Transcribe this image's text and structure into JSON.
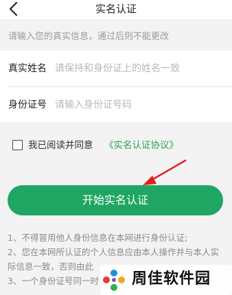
{
  "header": {
    "title": "实名认证"
  },
  "notice": "请输入您的真实信息，通过后则不能更改",
  "form": {
    "name_label": "真实姓名",
    "name_placeholder": "请保持和身份证上的姓名一致",
    "name_value": "",
    "id_label": "身份证号",
    "id_placeholder": "请输入身份证号码",
    "id_value": ""
  },
  "agreement": {
    "checked": false,
    "text": "我已阅读并同意",
    "link": "《实名认证协议》"
  },
  "start_button": "开始实名认证",
  "rules": [
    "1、不得冒用他人身份信息在本网进行身份认证;",
    "2、您在本网所认证的个人信息应由本人操作并与本人实际信息一致，否则由此",
    "3、一个身份证号同一时"
  ],
  "watermark": {
    "text": "周佳软件园"
  },
  "colors": {
    "accent": "#1ea662",
    "link": "#2aa35a",
    "annotation_arrow": "#e02020"
  }
}
